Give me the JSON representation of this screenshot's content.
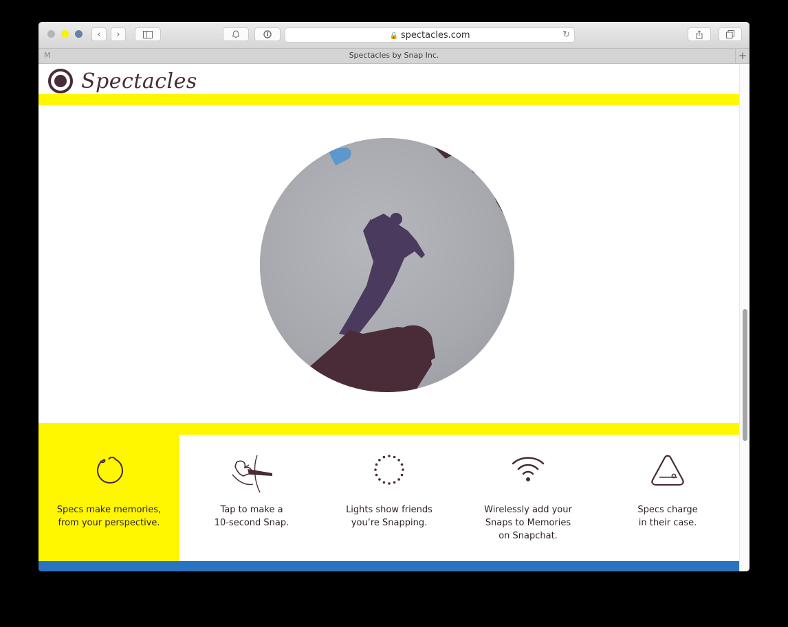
{
  "browser": {
    "url": "spectacles.com",
    "tab_title": "Spectacles by Snap Inc."
  },
  "page": {
    "logo_text": "Spectacles",
    "colors": {
      "yellow": "#fff700",
      "brand_dark": "#4a2b38",
      "blue": "#2a73c0"
    },
    "features": [
      {
        "icon": "circle-bitten-icon",
        "caption": "Specs make memories,\nfrom your perspective."
      },
      {
        "icon": "tap-hand-icon",
        "caption": "Tap to make a\n10-second Snap."
      },
      {
        "icon": "dotted-ring-icon",
        "caption": "Lights show friends\nyou’re Snapping."
      },
      {
        "icon": "wifi-icon",
        "caption": "Wirelessly add your\nSnaps to Memories\non Snapchat."
      },
      {
        "icon": "charging-case-icon",
        "caption": "Specs charge\nin their case."
      }
    ]
  }
}
